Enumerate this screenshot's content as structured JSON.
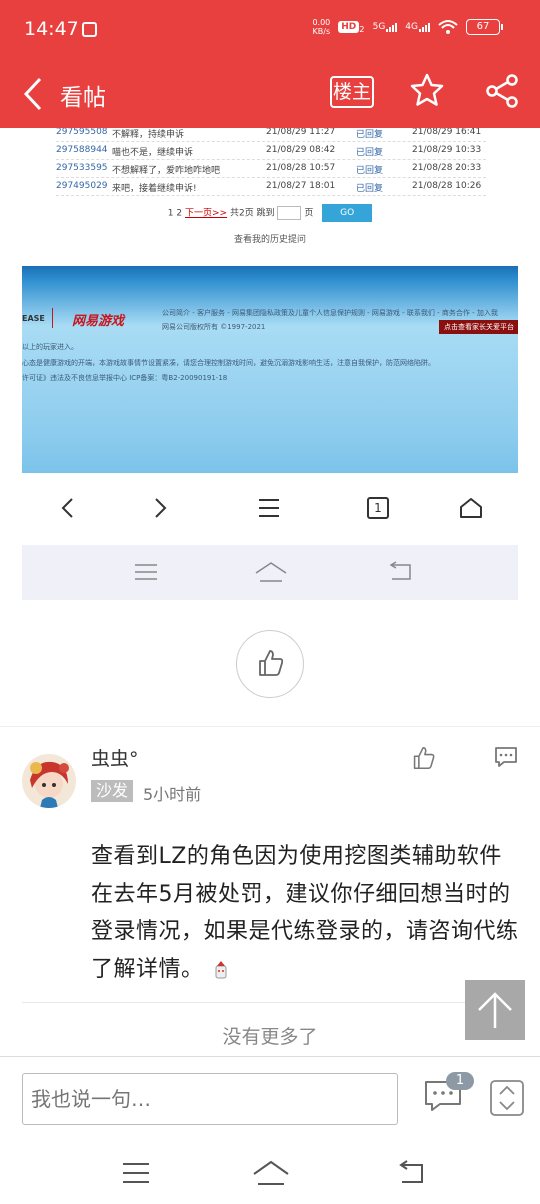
{
  "status_bar": {
    "time": "14:47",
    "net_speed": "0.00",
    "net_speed_unit": "KB/s",
    "hd_label": "HD",
    "hd_sub": "2",
    "network_5g": "5G",
    "network_4g": "4G",
    "battery": "67"
  },
  "app_bar": {
    "title": "看帖",
    "op_label": "楼主"
  },
  "embedded_screenshot": {
    "rows": [
      {
        "id": "297595508",
        "text": "不解释，持续申诉",
        "date1": "21/08/29 11:27",
        "status": "已回复",
        "date2": "21/08/29 16:41"
      },
      {
        "id": "297588944",
        "text": "喵也不是，继续申诉",
        "date1": "21/08/29 08:42",
        "status": "已回复",
        "date2": "21/08/29 10:33"
      },
      {
        "id": "297533595",
        "text": "不想解释了，爱咋地咋地吧",
        "date1": "21/08/28 10:57",
        "status": "已回复",
        "date2": "21/08/28 20:33"
      },
      {
        "id": "297495029",
        "text": "来吧，接着继续申诉!",
        "date1": "21/08/27 18:01",
        "status": "已回复",
        "date2": "21/08/28 10:26"
      }
    ],
    "pager_pages": "1 2",
    "pager_next": "下一页>>",
    "pager_total": "共2页 跳到",
    "pager_unit": "页",
    "pager_go": "GO",
    "history_link": "查看我的历史提问",
    "logo_left": "EASE",
    "logo_text": "网易游戏",
    "footer_links": "公司简介 - 客户服务 - 网易集团隐私政策及儿童个人信息保护规则 - 网易游戏 - 联系我们 - 商务合作 - 加入我",
    "copyright": "网易公司版权所有 ©1997-2021",
    "parent_badge": "点击查看家长关爱平台",
    "line1": "以上的玩家进入。",
    "line2": "心态是健康游戏的开端，本游戏故事情节设置紧凑，请您合理控制游戏时间，避免沉溺游戏影响生活，注意自我保护，防范网络陷阱。",
    "line3": "许可证》违法及不良信息举报中心 ICP备案：粤B2-20090191-18",
    "tab_count": "1"
  },
  "comment": {
    "username": "虫虫°",
    "tag": "沙发",
    "time": "5小时前",
    "body": "查看到LZ的角色因为使用挖图类辅助软件在去年5月被处罚，建议你仔细回想当时的登录情况，如果是代练登录的，请咨询代练了解详情。"
  },
  "no_more": "没有更多了",
  "reply_bar": {
    "placeholder": "我也说一句…",
    "comment_count": "1"
  },
  "colors": {
    "brand_red": "#e8403f",
    "go_blue": "#35a4d8"
  }
}
